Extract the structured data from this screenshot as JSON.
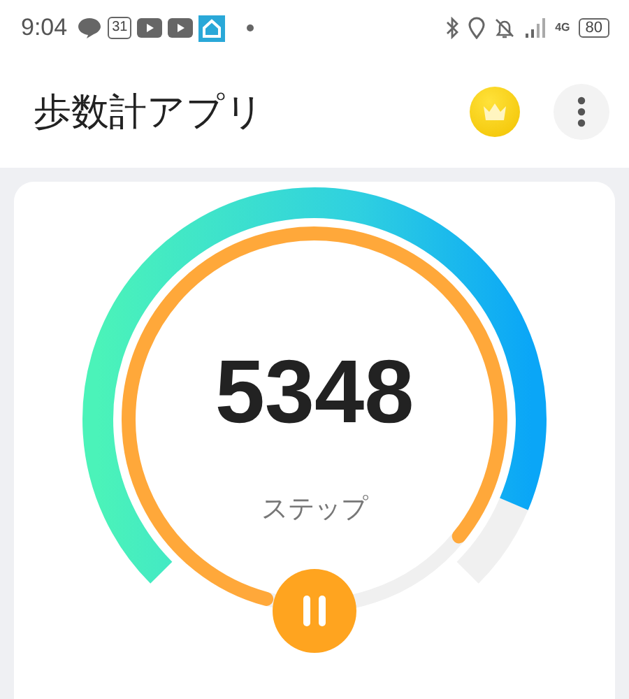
{
  "status_bar": {
    "time": "9:04",
    "calendar_date": "31",
    "network": "4G",
    "battery": "80"
  },
  "header": {
    "title": "歩数計アプリ"
  },
  "step_card": {
    "steps": "5348",
    "unit": "ステップ",
    "paused": false
  }
}
